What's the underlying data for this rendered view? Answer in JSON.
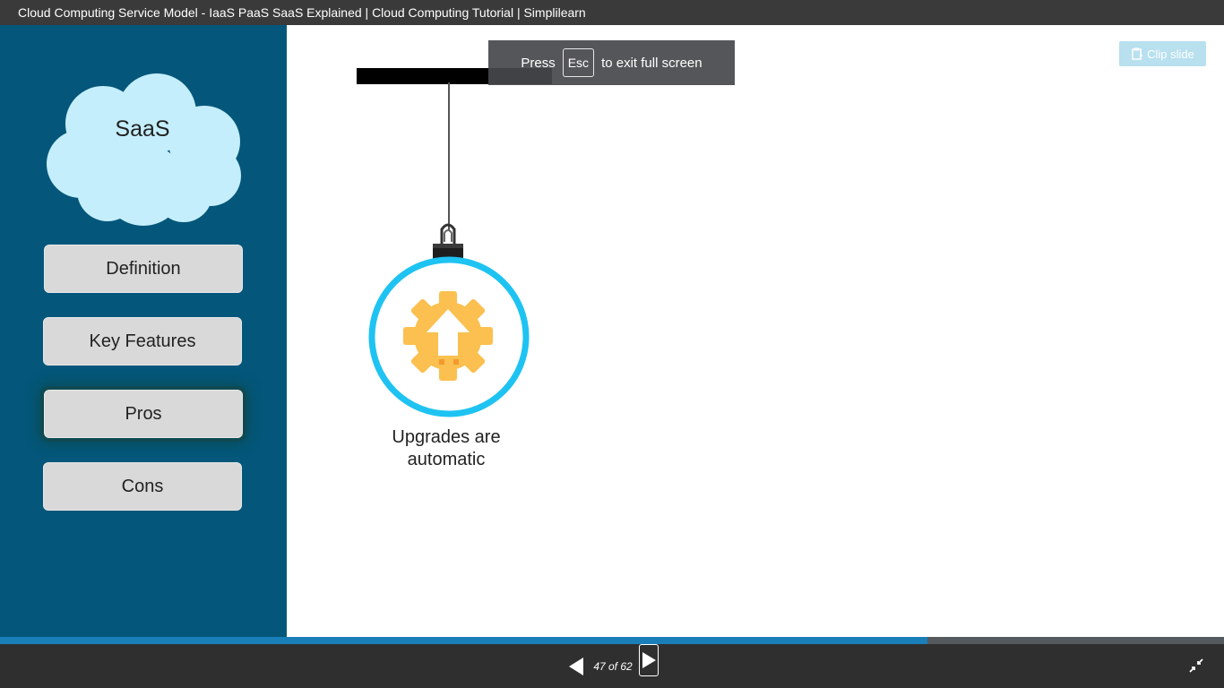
{
  "window": {
    "title": "Cloud Computing Service Model - IaaS PaaS SaaS Explained | Cloud Computing Tutorial | Simplilearn"
  },
  "sidebar": {
    "cloud_label": "SaaS",
    "items": [
      {
        "label": "Definition"
      },
      {
        "label": "Key Features"
      },
      {
        "label": "Pros"
      },
      {
        "label": "Cons"
      }
    ],
    "active_item": "Pros"
  },
  "slide": {
    "ornament_caption": "Upgrades are automatic",
    "icon": "gear-upload-icon"
  },
  "fullscreen_toast": {
    "press": "Press",
    "key": "Esc",
    "suffix": "to exit full screen"
  },
  "toolbar": {
    "clip_slide_label": "Clip slide"
  },
  "player": {
    "counter": "47 of 62",
    "current": 47,
    "total": 62,
    "progress_fraction": 0.758
  },
  "colors": {
    "sidebar": "#04577a",
    "cloud": "#c5eefc",
    "ring": "#1ec3f2",
    "gear": "#fbc04f",
    "progress": "#1a7fb8"
  }
}
